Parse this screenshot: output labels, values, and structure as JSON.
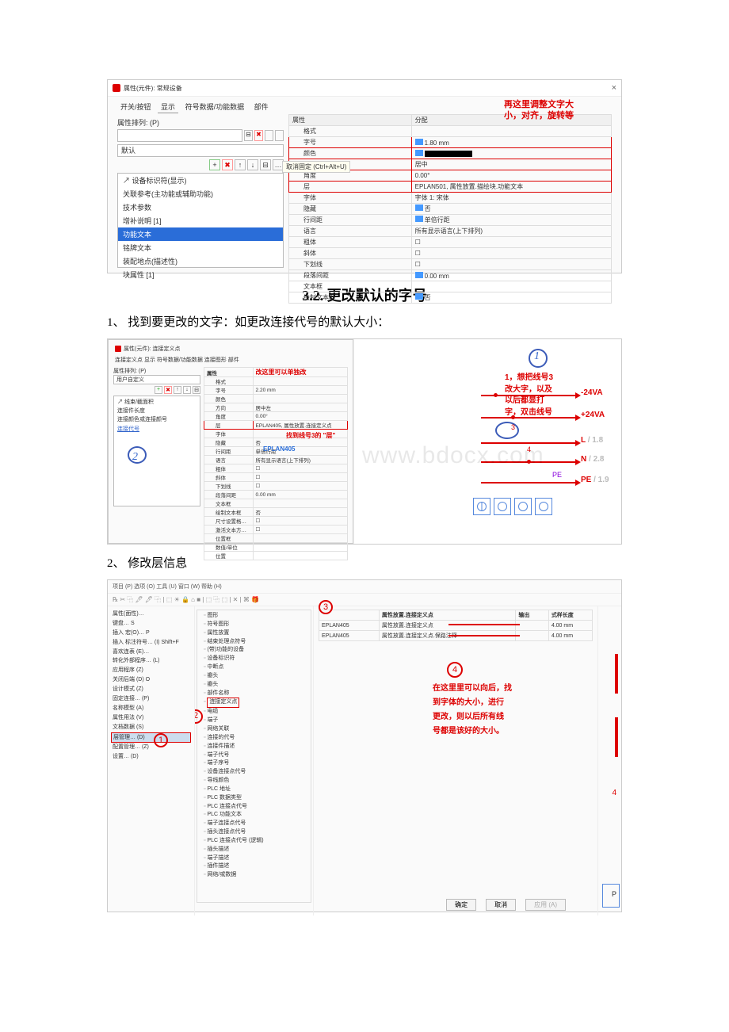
{
  "s1": {
    "windowTitle": "属性(元件): 常规设备",
    "closeIcon": "×",
    "tabs": [
      "开关/按钮",
      "显示",
      "符号数据/功能数据",
      "部件"
    ],
    "redNote1": "再这里调整文字大",
    "redNote2": "小，对齐，旋转等",
    "leftLabel": "属性排列: (P)",
    "defaultLabel": "默认",
    "tooltip": "取消固定 (Ctrl+Alt+U)",
    "iconPlus": "+",
    "iconX": "✖",
    "iconUp": "↑",
    "iconDown": "↓",
    "iconExtra": "⊟",
    "listItems": [
      "↗ 设备标识符(显示)",
      "关联参考(主功能或辅助功能)",
      "技术参数",
      "增补说明 [1]",
      "功能文本",
      "铭牌文本",
      "装配地点(描述性)",
      "块属性 [1]"
    ],
    "selectedIndex": 4,
    "colProp": "属性",
    "colAssign": "分配",
    "rows": [
      {
        "p": "格式",
        "v": ""
      },
      {
        "p": "字号",
        "v": "1.80 mm",
        "red": true,
        "blue": true
      },
      {
        "p": "颜色",
        "v": "__black__",
        "red": true,
        "blue": true
      },
      {
        "p": "方向",
        "v": "居中",
        "red": true
      },
      {
        "p": "角度",
        "v": "0.00°",
        "red": true
      },
      {
        "p": "层",
        "v": "EPLAN501, 属性放置.描绘块.功能文本",
        "red": true
      },
      {
        "p": "字体",
        "v": "字体 1: 宋体"
      },
      {
        "p": "隐藏",
        "v": "否",
        "blue": true
      },
      {
        "p": "行间距",
        "v": "单倍行距",
        "blue": true
      },
      {
        "p": "语言",
        "v": "所有显示语言(上下排列)"
      },
      {
        "p": "粗体",
        "v": "☐"
      },
      {
        "p": "斜体",
        "v": "☐"
      },
      {
        "p": "下划线",
        "v": "☐"
      },
      {
        "p": "段落间距",
        "v": "0.00 mm",
        "blue": true
      },
      {
        "p": "文本框",
        "v": ""
      },
      {
        "p": "绘制文本框",
        "v": "否",
        "blue": true
      }
    ]
  },
  "heading": "3.2. 更改默认的字号",
  "para1": "1、 找到要更改的文字：如更改连接代号的默认大小：",
  "para2": "2、 修改层信息",
  "s2": {
    "windowTitle": "属性(元件): 连接定义点",
    "tabs": "连接定义点  显示  符号数据/功能数据  连接图形  部件",
    "leftLabel": "属性排列: (P)",
    "userDef": "用户自定义",
    "listItems": [
      "↗ 线束/截面积",
      "连接件长度",
      "连接颜色或连接颜号",
      "连接代号"
    ],
    "colProp": "属性",
    "redTitle": "改这里可以单独改",
    "rows": [
      {
        "p": "格式",
        "v": ""
      },
      {
        "p": "字号",
        "v": "2.20 mm"
      },
      {
        "p": "颜色",
        "v": ""
      },
      {
        "p": "方向",
        "v": "居中左"
      },
      {
        "p": "角度",
        "v": "0.00°"
      },
      {
        "p": "层",
        "v": "EPLAN405, 属性放置.连接定义点"
      },
      {
        "p": "字体",
        "v": ""
      },
      {
        "p": "隐藏",
        "v": "否"
      },
      {
        "p": "行间距",
        "v": "单倍行距"
      },
      {
        "p": "语言",
        "v": "所有显示语言(上下排列)"
      },
      {
        "p": "粗体",
        "v": "☐"
      },
      {
        "p": "斜体",
        "v": "☐"
      },
      {
        "p": "下划线",
        "v": "☐"
      },
      {
        "p": "段落间距",
        "v": "0.00 mm"
      },
      {
        "p": "文本框",
        "v": ""
      },
      {
        "p": "绘制文本框",
        "v": "否"
      },
      {
        "p": "尺寸设置格…",
        "v": "☐"
      },
      {
        "p": "激活文本方…",
        "v": "☐"
      },
      {
        "p": "位置框",
        "v": ""
      },
      {
        "p": "数值/单位",
        "v": ""
      },
      {
        "p": "位置",
        "v": ""
      }
    ],
    "redNoteMid": "找到线号3的 \"层\"",
    "eplan": "EPLAN405",
    "annoR1": "1，想把线号3",
    "annoR2": "改大字，以及",
    "annoR3": "以后都显打",
    "annoR4": "字，双击线号",
    "wire1": "-24VA",
    "wire2": "+24VA",
    "wire3": "L",
    "wire3g": "/ 1.8",
    "wire4": "N",
    "wire4g": "/ 2.8",
    "wire5": "PE",
    "wire5g": "/ 1.9",
    "num3": "3",
    "num4": "4",
    "pePurple": "PE",
    "circle1": "1",
    "circle2": "2",
    "watermark": "www.bdocx.com"
  },
  "s3": {
    "menubar": "项目 (P)  选项 (O)  工具 (U)  窗口 (W)  帮助 (H)",
    "col1": [
      "属性(面性)…",
      "键盘…                         S",
      "插入 宏(O)…                   P",
      "插入 标注符号… (I)       Shift+F",
      "喜欢连表 (E)…",
      "转化外部程序… (L)",
      "应用程序 (Z)",
      "关闭后端 (D)                 O",
      "设计模式 (Z)",
      "固定连接… (P)",
      "名称模型 (A)",
      "属性用法 (V)",
      "文档数据 (S)",
      "层管理… (D)",
      "配置管理… (Z)",
      "设置… (D)"
    ],
    "col1SelIndex": 13,
    "circle1": "1",
    "col2": [
      "图形",
      "符号图形",
      "属性放置",
      "结束处理点符号",
      "(带)功能的设备",
      "设备标识符",
      "中断点",
      "瓣头",
      "瓣头",
      "部件名称",
      "连接定义点",
      "电缆",
      "端子",
      "网络关联",
      "连接的代号",
      "连接件描述",
      "端子代号",
      "端子序号",
      "设备连接点代号",
      "导线颜色",
      "PLC 地址",
      "PLC 数据类型",
      "PLC 连接点代号",
      "PLC 功能文本",
      "端子连接点代号",
      "插头连接点代号",
      "PLC 连接点代号 (逻辑)",
      "插头描述",
      "端子描述",
      "插件描述",
      "网络/或数据"
    ],
    "circle2": "2",
    "col3": {
      "cols": [
        "属性放置.连接定义点",
        "输出",
        "式样长度"
      ],
      "row1": [
        "EPLAN405",
        "属性放置.连接定义点",
        "",
        "4.00 mm"
      ],
      "row2": [
        "EPLAN405",
        "属性放置.连接定义点.保路注释",
        "",
        "4.00 mm"
      ],
      "circle3": "3",
      "circle4": "4",
      "anno1": "在这里里可以向后，找",
      "anno2": "到字体的大小，进行",
      "anno3": "更改，则以后所有线",
      "anno4": "号都是该好的大小。"
    },
    "btnOk": "确定",
    "btnCancel": "取消",
    "btnApply": "应用 (A)",
    "rightLabel4": "4",
    "rightLabelP": "P"
  }
}
